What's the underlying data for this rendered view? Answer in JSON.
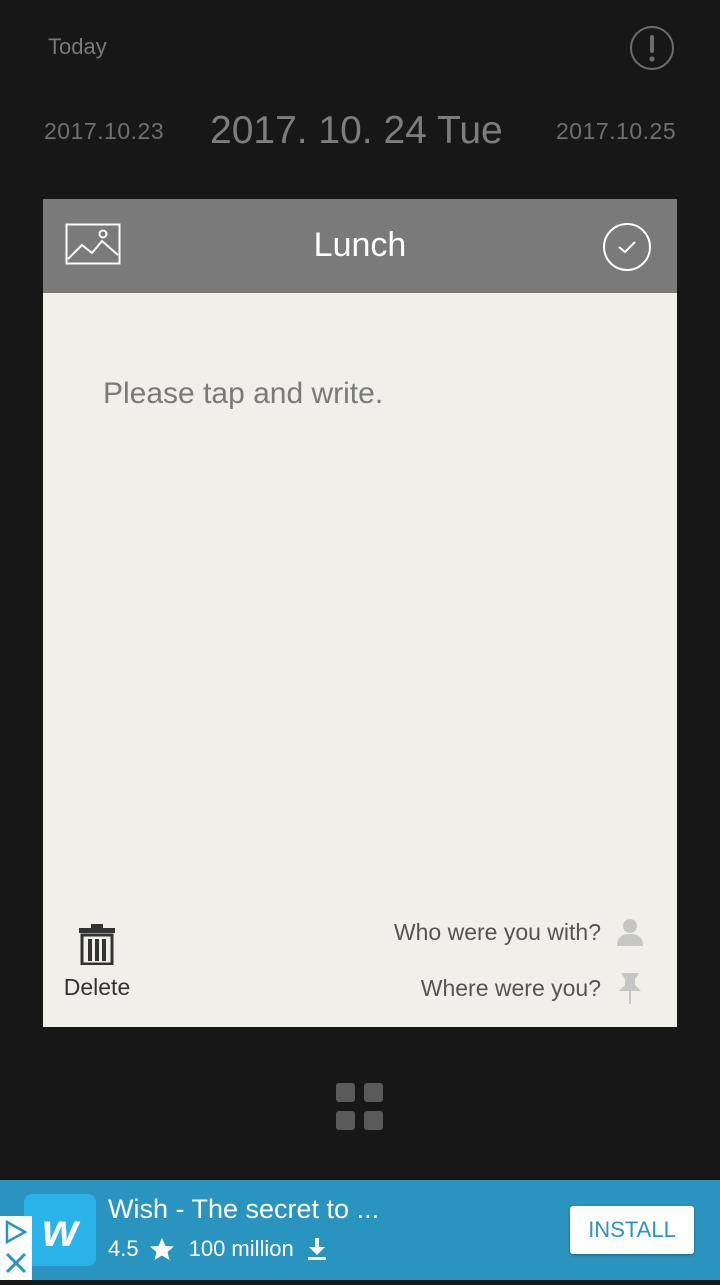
{
  "header": {
    "today_label": "Today",
    "info_icon": "exclamation-circle-icon"
  },
  "dates": {
    "previous": "2017.10.23",
    "current": "2017. 10. 24 Tue",
    "next": "2017.10.25"
  },
  "card": {
    "title": "Lunch",
    "image_icon": "image-icon",
    "confirm_icon": "check-circle-icon",
    "placeholder": "Please tap and write.",
    "delete_label": "Delete",
    "who_label": "Who were you with?",
    "where_label": "Where were you?"
  },
  "menu": {
    "icon": "grid-menu-icon"
  },
  "ad": {
    "title": "Wish - The secret to ...",
    "rating": "4.5",
    "installs": "100 million",
    "install_label": "INSTALL",
    "logo_text": "w",
    "colors": {
      "banner": "#2a94c0",
      "logo": "#2ab3e8"
    }
  },
  "colors": {
    "background": "#171717",
    "card_header": "#7a7a7a",
    "card_body": "#f0efea"
  }
}
